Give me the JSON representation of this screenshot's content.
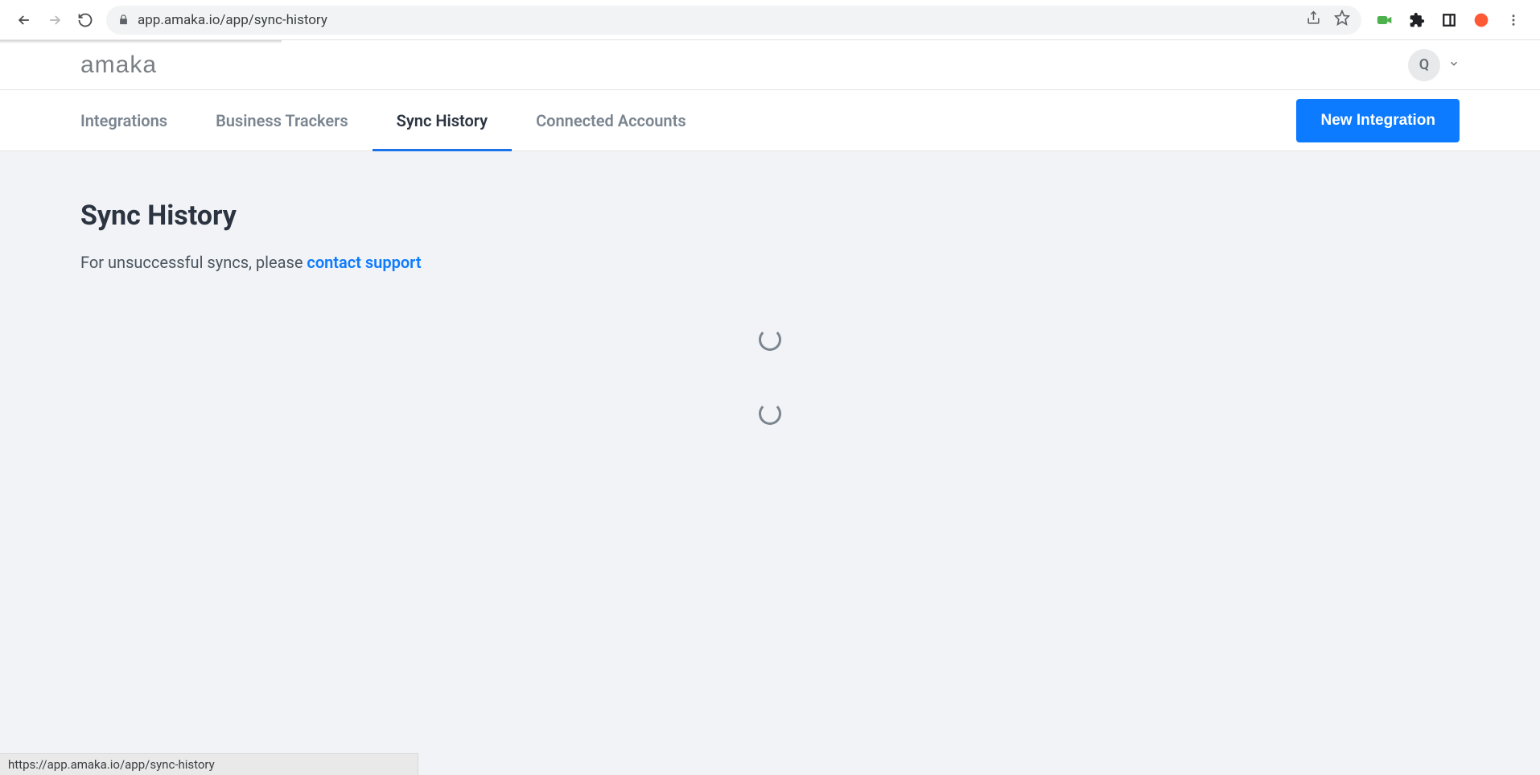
{
  "browser": {
    "url": "app.amaka.io/app/sync-history",
    "status_url": "https://app.amaka.io/app/sync-history"
  },
  "header": {
    "logo_text": "amaka",
    "avatar_initial": "Q"
  },
  "nav": {
    "tabs": [
      {
        "label": "Integrations",
        "active": false
      },
      {
        "label": "Business Trackers",
        "active": false
      },
      {
        "label": "Sync History",
        "active": true
      },
      {
        "label": "Connected Accounts",
        "active": false
      }
    ],
    "new_integration_label": "New Integration"
  },
  "page": {
    "title": "Sync History",
    "help_prefix": "For unsuccessful syncs, please ",
    "help_link_text": "contact support"
  }
}
